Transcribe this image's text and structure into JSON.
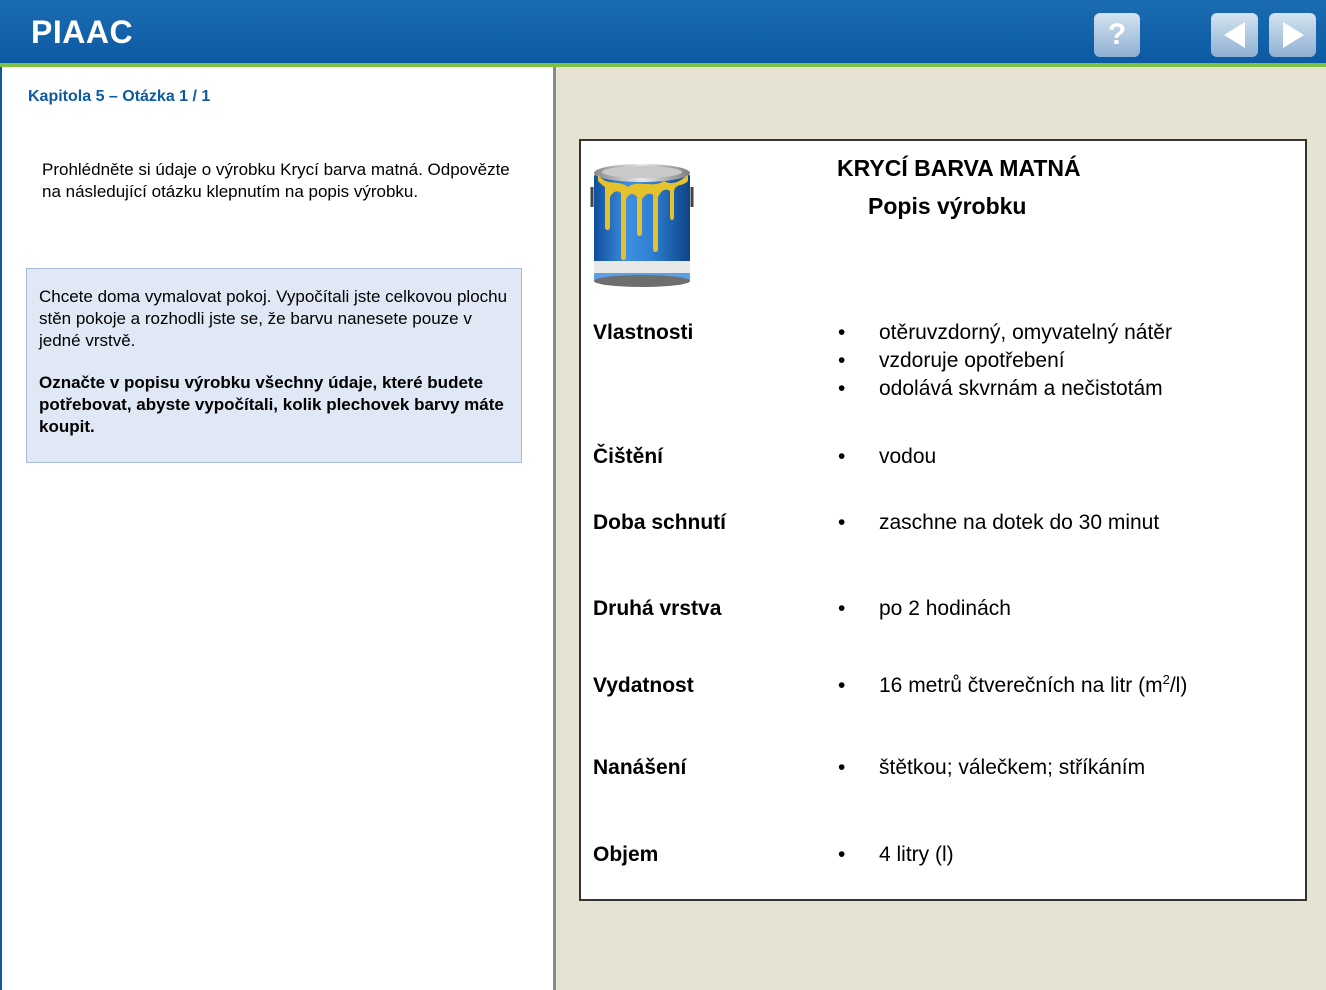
{
  "header": {
    "logo": "PIAAC",
    "help_label": "?",
    "colors": {
      "header_blue": "#0b5aa3",
      "accent_green": "#7cc142",
      "right_pane_bg": "#e6e3d2"
    },
    "icons": {
      "help": "question-mark-icon",
      "prev": "triangle-left-icon",
      "next": "triangle-right-icon"
    }
  },
  "left": {
    "chapter": "Kapitola 5 – Otázka 1 / 1",
    "intro": "Prohlédněte si údaje o výrobku Krycí barva matná. Odpovězte na následující otázku klepnutím na popis výrobku.",
    "task_text": "Chcete doma vymalovat pokoj. Vypočítali jste celkovou plochu stěn pokoje a rozhodli jste se, že barvu nanesete pouze v jedné vrstvě.",
    "task_question": "Označte v popisu výrobku všechny údaje, které budete potřebovat, abyste vypočítali, kolik plechovek barvy máte koupit."
  },
  "product": {
    "title": "KRYCÍ BARVA MATNÁ",
    "subtitle": "Popis výrobku",
    "rows": [
      {
        "label": "Vlastnosti",
        "items": [
          "otěruvzdorný, omyvatelný nátěr",
          "vzdoruje opotřebení",
          "odolává skvrnám a nečistotám"
        ]
      },
      {
        "label": "Čištění",
        "items": [
          "vodou"
        ]
      },
      {
        "label": "Doba schnutí",
        "items": [
          "zaschne na dotek do 30 minut"
        ]
      },
      {
        "label": "Druhá vrstva",
        "items": [
          "po 2 hodinách"
        ]
      },
      {
        "label": "Vydatnost",
        "items": [
          "16 metrů čtverečních na litr (m",
          "2",
          "/l)"
        ]
      },
      {
        "label": "Nanášení",
        "items": [
          "štětkou; válečkem; stříkáním"
        ]
      },
      {
        "label": "Objem",
        "items": [
          "4 litry (l)"
        ]
      }
    ]
  }
}
